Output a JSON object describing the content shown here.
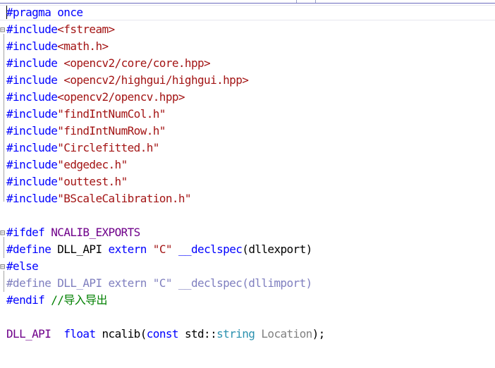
{
  "editor": {
    "lines": [
      {
        "tokens": [
          {
            "c": "kw",
            "t": "#pragma once"
          }
        ]
      },
      {
        "tokens": [
          {
            "c": "kw",
            "t": "#include"
          },
          {
            "c": "str",
            "t": "<fstream>"
          }
        ]
      },
      {
        "tokens": [
          {
            "c": "kw",
            "t": "#include"
          },
          {
            "c": "str",
            "t": "<math.h>"
          }
        ]
      },
      {
        "tokens": [
          {
            "c": "kw",
            "t": "#include"
          },
          {
            "c": "txt",
            "t": " "
          },
          {
            "c": "str",
            "t": "<opencv2/core/core.hpp>"
          }
        ]
      },
      {
        "tokens": [
          {
            "c": "kw",
            "t": "#include"
          },
          {
            "c": "txt",
            "t": " "
          },
          {
            "c": "str",
            "t": "<opencv2/highgui/highgui.hpp>"
          }
        ]
      },
      {
        "tokens": [
          {
            "c": "kw",
            "t": "#include"
          },
          {
            "c": "str",
            "t": "<opencv2/opencv.hpp>"
          }
        ]
      },
      {
        "tokens": [
          {
            "c": "kw",
            "t": "#include"
          },
          {
            "c": "str",
            "t": "\"findIntNumCol.h\""
          }
        ]
      },
      {
        "tokens": [
          {
            "c": "kw",
            "t": "#include"
          },
          {
            "c": "str",
            "t": "\"findIntNumRow.h\""
          }
        ]
      },
      {
        "tokens": [
          {
            "c": "kw",
            "t": "#include"
          },
          {
            "c": "str",
            "t": "\"Circlefitted.h\""
          }
        ]
      },
      {
        "tokens": [
          {
            "c": "kw",
            "t": "#include"
          },
          {
            "c": "str",
            "t": "\"edgedec.h\""
          }
        ]
      },
      {
        "tokens": [
          {
            "c": "kw",
            "t": "#include"
          },
          {
            "c": "str",
            "t": "\"outtest.h\""
          }
        ]
      },
      {
        "tokens": [
          {
            "c": "kw",
            "t": "#include"
          },
          {
            "c": "str",
            "t": "\"BScaleCalibration.h\""
          }
        ]
      },
      {
        "tokens": []
      },
      {
        "tokens": [
          {
            "c": "kw",
            "t": "#ifdef"
          },
          {
            "c": "txt",
            "t": " "
          },
          {
            "c": "fmacro",
            "t": "NCALIB_EXPORTS"
          }
        ]
      },
      {
        "tokens": [
          {
            "c": "kw",
            "t": "#define"
          },
          {
            "c": "txt",
            "t": " DLL_API "
          },
          {
            "c": "kw",
            "t": "extern"
          },
          {
            "c": "txt",
            "t": " "
          },
          {
            "c": "str",
            "t": "\"C\""
          },
          {
            "c": "txt",
            "t": " "
          },
          {
            "c": "kw",
            "t": "__declspec"
          },
          {
            "c": "txt",
            "t": "(dllexport)"
          }
        ]
      },
      {
        "tokens": [
          {
            "c": "kw",
            "t": "#else"
          }
        ]
      },
      {
        "tokens": [
          {
            "c": "grey",
            "t": "#define DLL_API extern \"C\" __declspec(dllimport)"
          }
        ]
      },
      {
        "tokens": [
          {
            "c": "kw",
            "t": "#endif"
          },
          {
            "c": "txt",
            "t": " "
          },
          {
            "c": "cmt",
            "t": "//导入导出"
          }
        ]
      },
      {
        "tokens": []
      },
      {
        "tokens": [
          {
            "c": "fmacro",
            "t": "DLL_API"
          },
          {
            "c": "txt",
            "t": "  "
          },
          {
            "c": "kw",
            "t": "float"
          },
          {
            "c": "txt",
            "t": " ncalib("
          },
          {
            "c": "kw",
            "t": "const"
          },
          {
            "c": "txt",
            "t": " std::"
          },
          {
            "c": "type",
            "t": "string"
          },
          {
            "c": "txt",
            "t": " "
          },
          {
            "c": "param",
            "t": "Location"
          },
          {
            "c": "txt",
            "t": ");"
          }
        ]
      }
    ]
  }
}
